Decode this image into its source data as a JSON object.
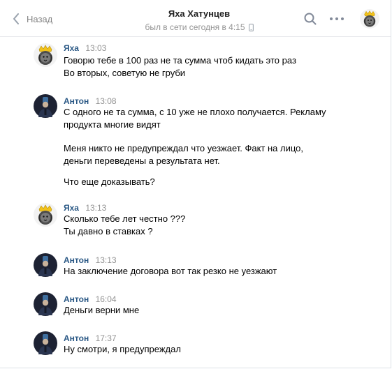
{
  "header": {
    "back_label": "Назад",
    "title": "Яха Хатунцев",
    "status": "был в сети сегодня в 4:15"
  },
  "messages": [
    {
      "author": "Яха",
      "time": "13:03",
      "avatar": "lion-avatar",
      "lines": [
        "Говорю тебе в 100 раз не та сумма чтоб кидать это раз",
        "Во вторых, советую не груби"
      ]
    },
    {
      "author": "Антон",
      "time": "13:08",
      "avatar": "person-avatar",
      "lines": [
        "С одного не та сумма, с 10 уже не плохо получается. Рекламу",
        "продукта многие видят",
        "Меня никто не предупреждал что уезжает. Факт на лицо,",
        "деньги переведены а результата нет.",
        "Что еще доказывать?"
      ]
    },
    {
      "author": "Яха",
      "time": "13:13",
      "avatar": "lion-avatar",
      "lines": [
        "Сколько тебе лет честно ???",
        "Ты давно в ставках ?"
      ]
    },
    {
      "author": "Антон",
      "time": "13:13",
      "avatar": "person-avatar",
      "lines": [
        "На заключение договора вот так резко не уезжают"
      ]
    },
    {
      "author": "Антон",
      "time": "16:04",
      "avatar": "person-avatar",
      "lines": [
        "Деньги верни мне"
      ]
    },
    {
      "author": "Антон",
      "time": "17:37",
      "avatar": "person-avatar",
      "lines": [
        "Ну смотри, я предупреждал"
      ]
    }
  ],
  "colors": {
    "author": "#2a5885",
    "timestamp": "#939393",
    "divider": "#e7e8ec",
    "back_label": "#828282"
  },
  "icons": {
    "back": "chevron-left-icon",
    "search": "search-icon",
    "more": "more-dots-icon",
    "status_device": "phone-icon"
  }
}
